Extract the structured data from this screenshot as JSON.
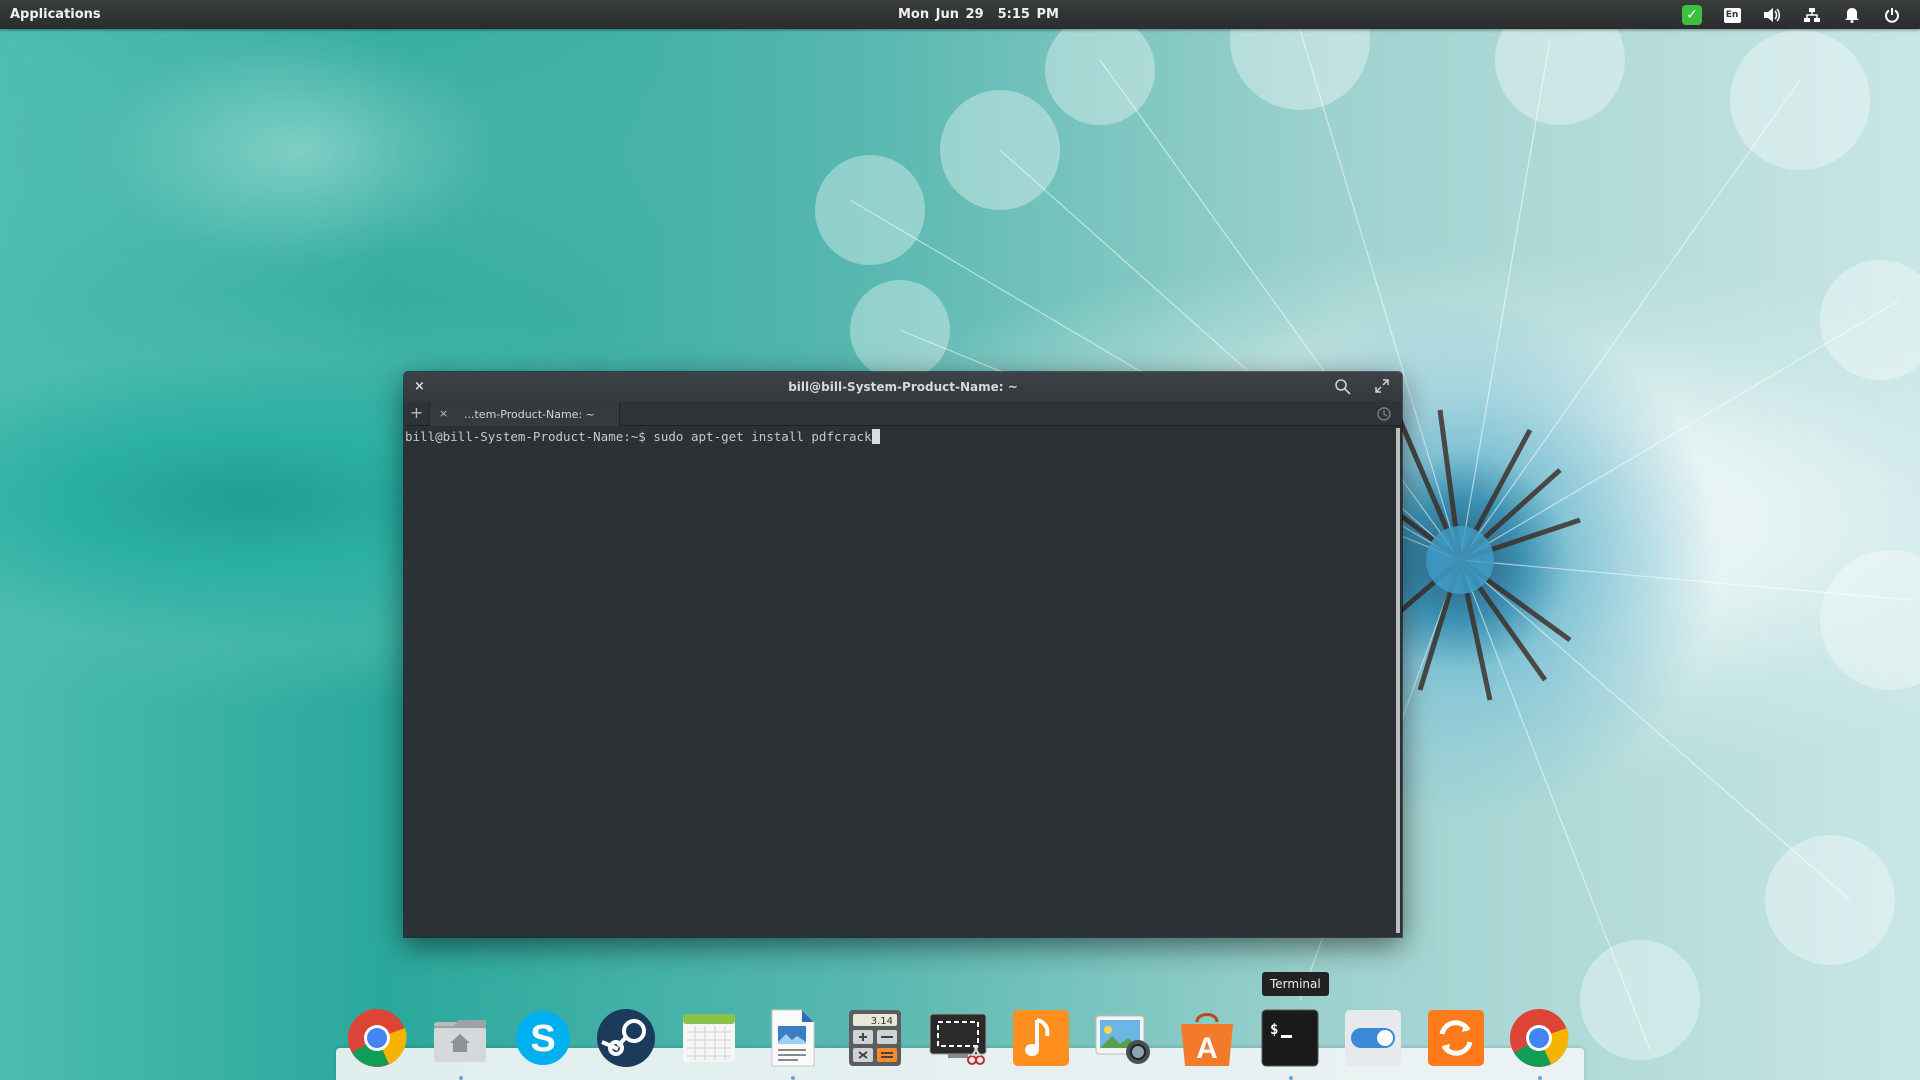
{
  "top_panel": {
    "applications_label": "Applications",
    "date": "Mon Jun 29",
    "time": "5:15 PM",
    "indicators": [
      {
        "name": "check-icon",
        "glyph": "✓"
      },
      {
        "name": "keyboard-layout",
        "label": "En"
      },
      {
        "name": "volume-icon",
        "glyph": "🔊"
      },
      {
        "name": "network-icon",
        "glyph": "⧉"
      },
      {
        "name": "notifications-icon",
        "glyph": "🔔"
      },
      {
        "name": "power-icon",
        "glyph": "⏻"
      }
    ]
  },
  "terminal": {
    "window_title": "bill@bill-System-Product-Name: ~",
    "close_glyph": "×",
    "new_tab_glyph": "+",
    "tab_close_glyph": "×",
    "tab_label": "...tem-Product-Name: ~",
    "prompt": "bill@bill-System-Product-Name:~$ ",
    "command": "sudo apt-get install pdfcrack"
  },
  "dock": {
    "tooltip": "Terminal",
    "items": [
      {
        "name": "chrome"
      },
      {
        "name": "files"
      },
      {
        "name": "skype"
      },
      {
        "name": "steam"
      },
      {
        "name": "calendar"
      },
      {
        "name": "libreoffice-writer"
      },
      {
        "name": "calculator",
        "label": "3.14"
      },
      {
        "name": "screenshot"
      },
      {
        "name": "music"
      },
      {
        "name": "photos"
      },
      {
        "name": "app-center",
        "label": "A"
      },
      {
        "name": "terminal",
        "label": "$_"
      },
      {
        "name": "switchboard-settings"
      },
      {
        "name": "software-updater"
      },
      {
        "name": "chrome-2"
      }
    ]
  },
  "colors": {
    "panel": "#2e3031",
    "terminal_bg": "#2b3135",
    "accent": "#6aa6d6"
  }
}
